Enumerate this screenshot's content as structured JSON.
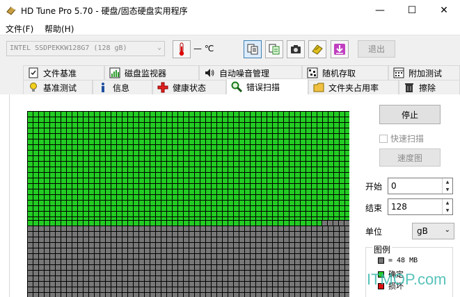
{
  "window": {
    "title": "HD Tune Pro 5.70 - 硬盘/固态硬盘实用程序",
    "minimize": "—",
    "maximize": "☐",
    "close": "✕"
  },
  "menu": {
    "file": "文件(F)",
    "help": "帮助(H)"
  },
  "toolbar": {
    "drive": "INTEL SSDPEKKW128G7 (128 gB)",
    "temperature": "— ℃",
    "exit": "退出"
  },
  "tabs_row1": [
    {
      "label": "文件基准",
      "icon": "file-benchmark-icon"
    },
    {
      "label": "磁盘监视器",
      "icon": "disk-monitor-icon"
    },
    {
      "label": "自动噪音管理",
      "icon": "speaker-icon"
    },
    {
      "label": "随机存取",
      "icon": "random-access-icon"
    },
    {
      "label": "附加测试",
      "icon": "extra-tests-icon"
    }
  ],
  "tabs_row2": [
    {
      "label": "基准测试",
      "icon": "benchmark-icon"
    },
    {
      "label": "信息",
      "icon": "info-icon"
    },
    {
      "label": "健康状态",
      "icon": "health-icon"
    },
    {
      "label": "错误扫描",
      "icon": "magnifier-icon",
      "active": true
    },
    {
      "label": "文件夹占用率",
      "icon": "folder-icon"
    },
    {
      "label": "擦除",
      "icon": "trash-icon"
    }
  ],
  "scan": {
    "progress_fraction": 0.61,
    "good_color": "#22cc22",
    "pending_color": "#777777"
  },
  "controls": {
    "stop": "停止",
    "quick_scan": "快速扫描",
    "map": "速度图",
    "start_label": "开始",
    "start_value": "0",
    "end_label": "结束",
    "end_value": "128",
    "unit_label": "单位",
    "unit_value": "gB"
  },
  "legend": {
    "title": "图例",
    "block_size": "= 48 MB",
    "ok": "确定",
    "damaged": "损坏"
  },
  "watermark": "ITMOP.com"
}
